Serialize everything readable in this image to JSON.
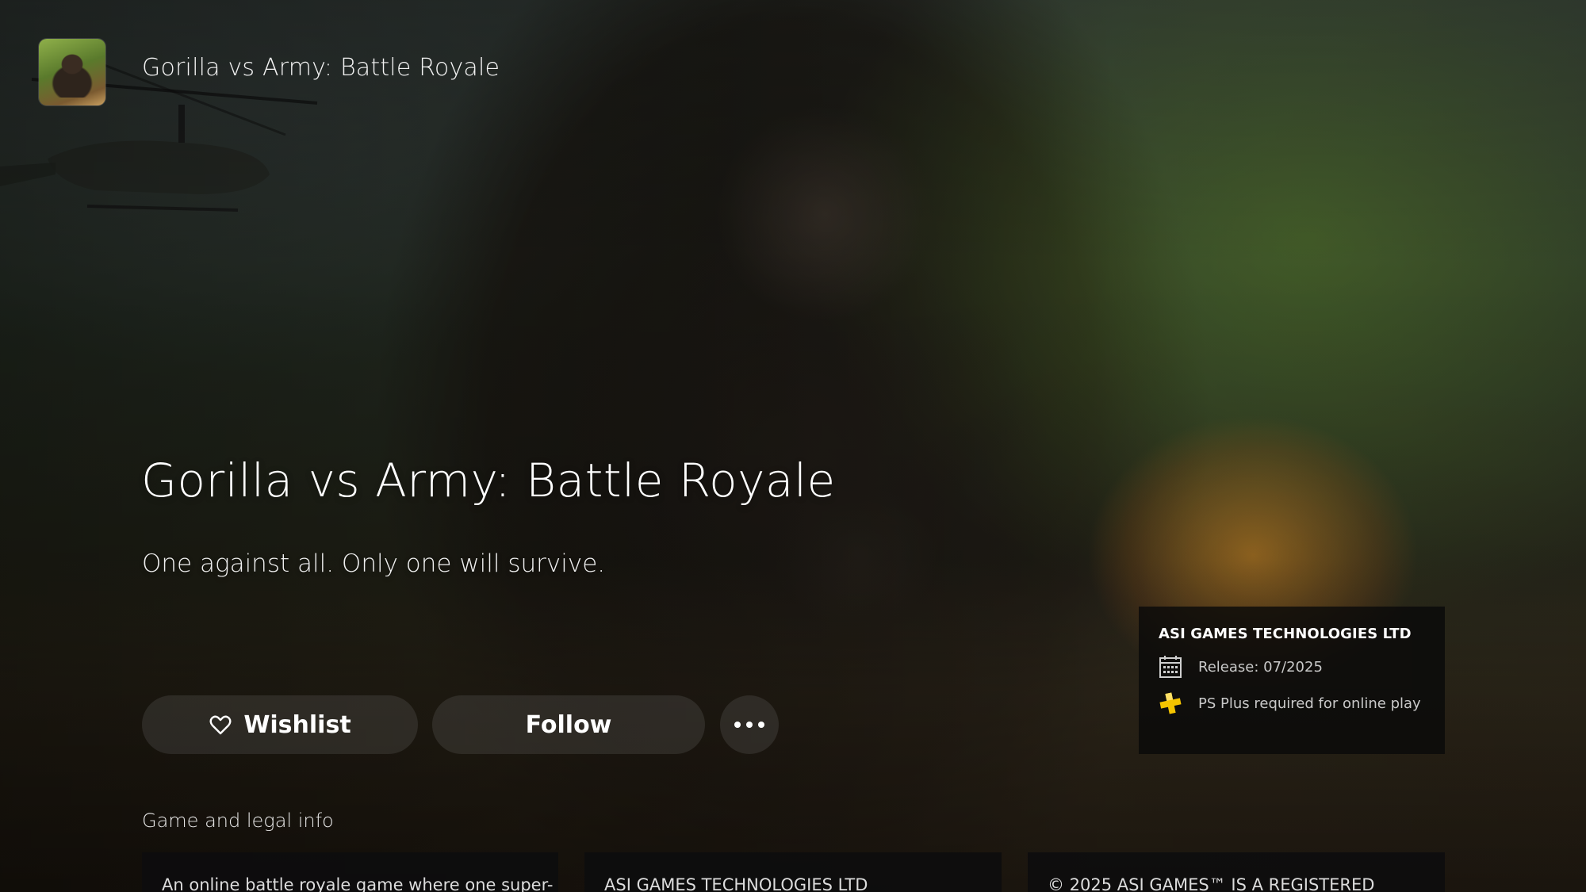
{
  "header": {
    "app_title": "Gorilla vs Army: Battle Royale",
    "app_icon": "gorilla-game-icon"
  },
  "hero": {
    "title": "Gorilla vs Army: Battle Royale",
    "tagline": "One against all. Only one will survive."
  },
  "actions": {
    "wishlist_label": "Wishlist",
    "wishlist_icon": "heart-icon",
    "follow_label": "Follow",
    "more_icon": "more-options-icon"
  },
  "info_panel": {
    "publisher": "ASI GAMES TECHNOLOGIES LTD",
    "release_label": "Release: 07/2025",
    "release_icon": "calendar-icon",
    "psplus_label": "PS Plus required for online play",
    "psplus_icon": "ps-plus-icon",
    "psplus_color": "#f5c400"
  },
  "legal": {
    "section_label": "Game and legal info",
    "cards": [
      "An online battle royale game where one super-",
      "ASI GAMES TECHNOLOGIES LTD",
      "© 2025 ASI GAMES™ IS A REGISTERED"
    ]
  }
}
